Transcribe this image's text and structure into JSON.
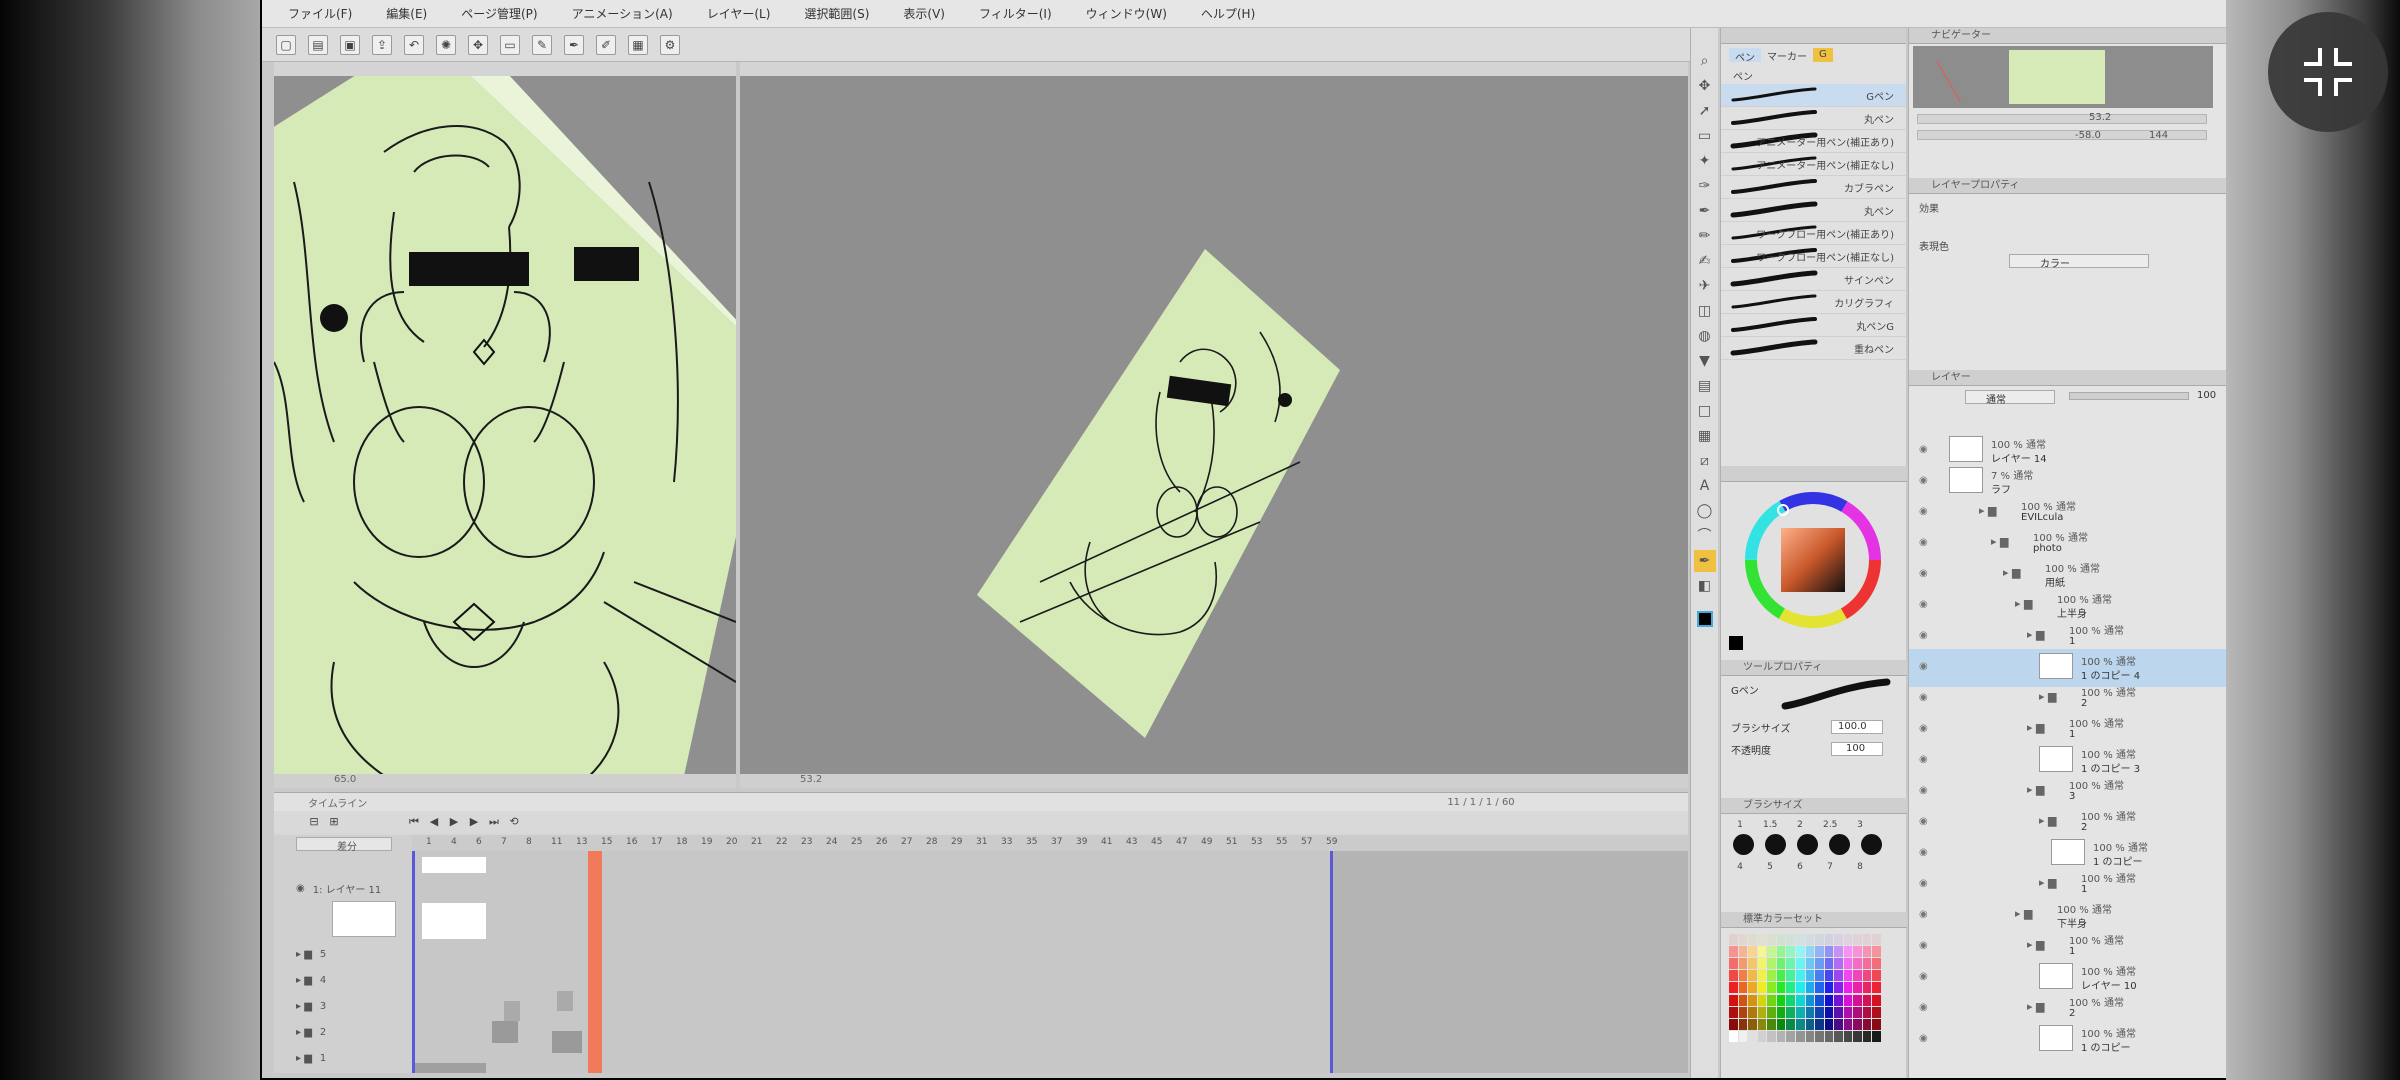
{
  "menubar": {
    "items": [
      "ファイル(F)",
      "編集(E)",
      "ページ管理(P)",
      "アニメーション(A)",
      "レイヤー(L)",
      "選択範囲(S)",
      "表示(V)",
      "フィルター(I)",
      "ウィンドウ(W)",
      "ヘルプ(H)"
    ]
  },
  "brush_panel": {
    "tabs": [
      "ペン",
      "マーカー",
      "G"
    ],
    "subtab": "ペン",
    "brushes": [
      "Gペン",
      "丸ペン",
      "アニメーター用ペン(補正あり)",
      "アニメーター用ペン(補正なし)",
      "カブラペン",
      "丸ペン",
      "ワークフロー用ペン(補正あり)",
      "ワークフロー用ペン(補正なし)",
      "サインペン",
      "カリグラフィ",
      "丸ペンG",
      "重ねペン"
    ]
  },
  "tool_property": {
    "title": "ツールプロパティ",
    "tool_name": "Gペン",
    "size_label": "ブラシサイズ",
    "size_value": "100.0",
    "opacity_label": "不透明度",
    "opacity_value": "100"
  },
  "brush_size_panel": {
    "title": "ブラシサイズ",
    "sizes_top": [
      "1",
      "1.5",
      "2",
      "2.5",
      "3"
    ],
    "sizes_bottom": [
      "4",
      "5",
      "6",
      "7",
      "8"
    ]
  },
  "color_set": {
    "title": "標準カラーセット"
  },
  "navigator": {
    "title": "ナビゲーター",
    "zoom": "53.2",
    "angle": "-58.0",
    "zoom_extra": "144"
  },
  "layer_property": {
    "title": "レイヤープロパティ",
    "effect_label": "効果",
    "expression_label": "表現色",
    "expression_value": "カラー"
  },
  "layers_panel": {
    "title": "レイヤー",
    "blend_mode": "通常",
    "opacity": "100",
    "layers": [
      {
        "line1": "100 % 通常",
        "line2": "レイヤー 14"
      },
      {
        "line1": "7 % 通常",
        "line2": "ラフ"
      },
      {
        "line1": "100 % 通常",
        "line2": "EVILcula"
      },
      {
        "line1": "100 % 通常",
        "line2": "photo"
      },
      {
        "line1": "100 % 通常",
        "line2": "用紙"
      },
      {
        "line1": "100 % 通常",
        "line2": "上半身"
      },
      {
        "line1": "100 % 通常",
        "line2": "1"
      },
      {
        "line1": "100 % 通常",
        "line2": "1 のコピー 4"
      },
      {
        "line1": "100 % 通常",
        "line2": "2"
      },
      {
        "line1": "100 % 通常",
        "line2": "1"
      },
      {
        "line1": "100 % 通常",
        "line2": "1 のコピー 3"
      },
      {
        "line1": "100 % 通常",
        "line2": "3"
      },
      {
        "line1": "100 % 通常",
        "line2": "2"
      },
      {
        "line1": "100 % 通常",
        "line2": "1 のコピー"
      },
      {
        "line1": "100 % 通常",
        "line2": "1"
      },
      {
        "line1": "100 % 通常",
        "line2": "下半身"
      },
      {
        "line1": "100 % 通常",
        "line2": "1"
      },
      {
        "line1": "100 % 通常",
        "line2": "レイヤー 10"
      },
      {
        "line1": "100 % 通常",
        "line2": "2"
      },
      {
        "line1": "100 % 通常",
        "line2": "1 のコピー"
      }
    ]
  },
  "timeline": {
    "title": "タイムライン",
    "mode": "差分",
    "frames": [
      "1",
      "4",
      "6",
      "7",
      "8",
      "11",
      "13",
      "15",
      "16",
      "17",
      "18",
      "19",
      "20",
      "21",
      "22",
      "23",
      "24",
      "25",
      "26",
      "27",
      "28",
      "29",
      "31",
      "33",
      "35",
      "37",
      "39",
      "41",
      "43",
      "45",
      "47",
      "49",
      "51",
      "53",
      "55",
      "57",
      "59"
    ],
    "tracks": [
      "1: レイヤー 11",
      "5",
      "4",
      "3",
      "2",
      "1"
    ],
    "counter": "11 / 1 / 1 / 60"
  },
  "view_status": {
    "left": "65.0",
    "right": "53.2"
  },
  "exit_fullscreen": {
    "icon": "exit-fullscreen-icon"
  },
  "colors": {
    "canvas_green": "#d6eab8",
    "playhead": "#f07a5a",
    "selection_blue": "#bcd6ee"
  }
}
